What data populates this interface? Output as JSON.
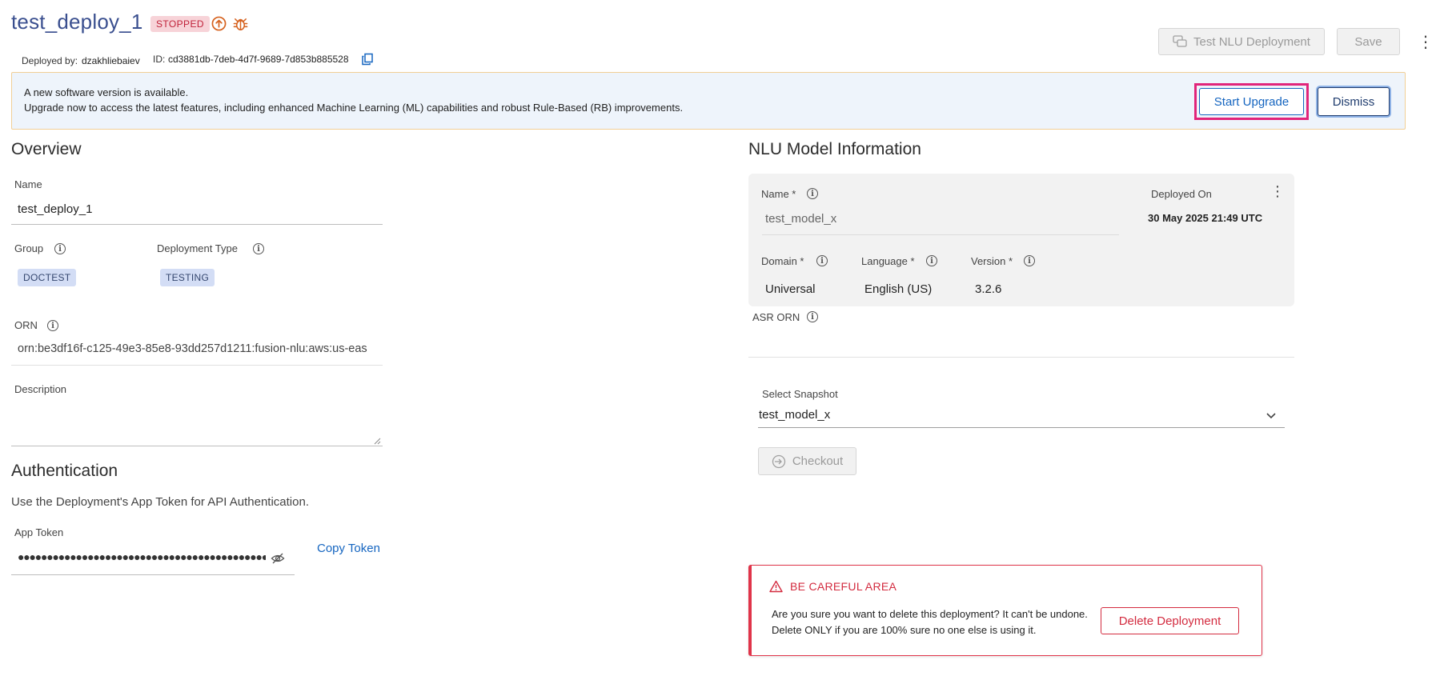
{
  "header": {
    "title": "test_deploy_1",
    "status_badge": "STOPPED",
    "deployed_by_label": "Deployed by:",
    "deployed_by": "dzakhliebaiev",
    "id_label": "ID:",
    "id": "cd3881db-7deb-4d7f-9689-7d853b885528",
    "test_button": "Test NLU Deployment",
    "save_button": "Save",
    "kebab": "⋮"
  },
  "banner": {
    "title": "A new software version is available.",
    "text": "Upgrade now to access the latest features, including enhanced Machine Learning (ML) capabilities and robust Rule-Based (RB) improvements.",
    "upgrade_button": "Start Upgrade",
    "dismiss_button": "Dismiss"
  },
  "overview": {
    "heading": "Overview",
    "name_label": "Name",
    "name_value": "test_deploy_1",
    "group_label": "Group",
    "group_value": "DOCTEST",
    "type_label": "Deployment Type",
    "type_value": "TESTING",
    "orn_label": "ORN",
    "orn_value": "orn:be3df16f-c125-49e3-85e8-93dd257d1211:fusion-nlu:aws:us-eas",
    "description_label": "Description"
  },
  "authentication": {
    "heading": "Authentication",
    "description": "Use the Deployment's App Token for API Authentication.",
    "token_label": "App Token",
    "token_value": "●●●●●●●●●●●●●●●●●●●●●●●●●●●●●●●●●●●●●●●●●●●●●",
    "copy_token": "Copy Token"
  },
  "nlu": {
    "heading": "NLU Model Information",
    "name_label": "Name *",
    "name_value": "test_model_x",
    "deployed_on_label": "Deployed On",
    "deployed_on_value": "30 May 2025 21:49 UTC",
    "domain_label": "Domain *",
    "domain_value": "Universal",
    "language_label": "Language *",
    "language_value": "English (US)",
    "version_label": "Version *",
    "version_value": "3.2.6",
    "asr_orn_label": "ASR ORN",
    "snapshot_label": "Select Snapshot",
    "snapshot_value": "test_model_x",
    "checkout_button": "Checkout",
    "kebab": "⋮"
  },
  "careful": {
    "title": "BE CAREFUL AREA",
    "text": "Are you sure you want to delete this deployment? It can't be undone. Delete ONLY if you are 100% sure no one else is using it.",
    "delete_button": "Delete Deployment"
  },
  "colors": {
    "title_blue": "#3a4f8f",
    "primary_blue": "#1565c0",
    "danger_red": "#d32b3f",
    "highlight_pink": "#e1247a",
    "banner_bg": "#eef4fb",
    "banner_border": "#f1cf96"
  }
}
